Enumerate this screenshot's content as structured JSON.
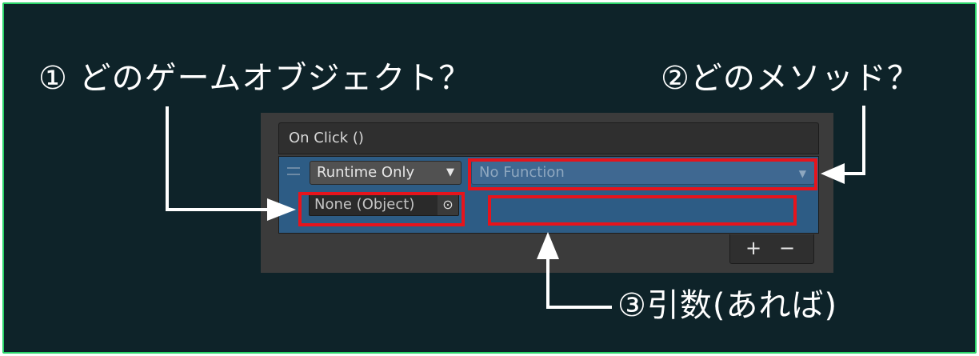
{
  "annotations": {
    "gameobject_question": "① どのゲームオブジェクト？",
    "method_question": "②どのメソッド？",
    "argument_note": "③引数(あれば)"
  },
  "event_panel": {
    "header": "On Click ()",
    "runtime_dropdown": "Runtime Only",
    "function_dropdown": "No Function",
    "object_field": "None (Object)",
    "argument_field": "",
    "add_button": "+",
    "remove_button": "−"
  },
  "icons": {
    "dropdown_arrow": "chevron-down-icon",
    "object_picker": "target-icon",
    "drag_handle": "drag-handle-icon"
  },
  "colors": {
    "background": "#0e2329",
    "frame_border": "#2bd46a",
    "highlight": "#e6141c",
    "row_selected": "#2d5c85"
  }
}
